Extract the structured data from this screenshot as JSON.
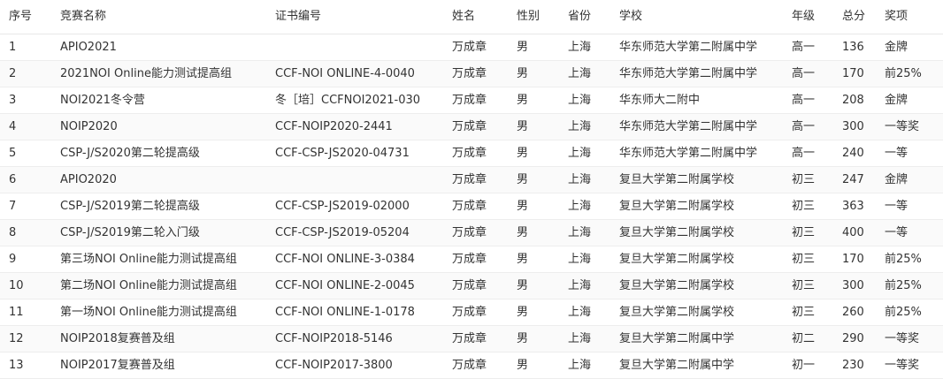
{
  "headers": [
    "序号",
    "竞赛名称",
    "证书编号",
    "姓名",
    "性别",
    "省份",
    "学校",
    "年级",
    "总分",
    "奖项"
  ],
  "rows": [
    {
      "idx": "1",
      "contest": "APIO2021",
      "cert": "",
      "name": "万成章",
      "gender": "男",
      "province": "上海",
      "school": "华东师范大学第二附属中学",
      "grade": "高一",
      "score": "136",
      "award": "金牌"
    },
    {
      "idx": "2",
      "contest": "2021NOI Online能力测试提高组",
      "cert": "CCF-NOI ONLINE-4-0040",
      "name": "万成章",
      "gender": "男",
      "province": "上海",
      "school": "华东师范大学第二附属中学",
      "grade": "高一",
      "score": "170",
      "award": "前25%"
    },
    {
      "idx": "3",
      "contest": "NOI2021冬令营",
      "cert": "冬［培］CCFNOI2021-030",
      "name": "万成章",
      "gender": "男",
      "province": "上海",
      "school": "华东师大二附中",
      "grade": "高一",
      "score": "208",
      "award": "金牌"
    },
    {
      "idx": "4",
      "contest": "NOIP2020",
      "cert": "CCF-NOIP2020-2441",
      "name": "万成章",
      "gender": "男",
      "province": "上海",
      "school": "华东师范大学第二附属中学",
      "grade": "高一",
      "score": "300",
      "award": "一等奖"
    },
    {
      "idx": "5",
      "contest": "CSP-J/S2020第二轮提高级",
      "cert": "CCF-CSP-JS2020-04731",
      "name": "万成章",
      "gender": "男",
      "province": "上海",
      "school": "华东师范大学第二附属中学",
      "grade": "高一",
      "score": "240",
      "award": "一等"
    },
    {
      "idx": "6",
      "contest": "APIO2020",
      "cert": "",
      "name": "万成章",
      "gender": "男",
      "province": "上海",
      "school": "复旦大学第二附属学校",
      "grade": "初三",
      "score": "247",
      "award": "金牌"
    },
    {
      "idx": "7",
      "contest": "CSP-J/S2019第二轮提高级",
      "cert": "CCF-CSP-JS2019-02000",
      "name": "万成章",
      "gender": "男",
      "province": "上海",
      "school": "复旦大学第二附属学校",
      "grade": "初三",
      "score": "363",
      "award": "一等"
    },
    {
      "idx": "8",
      "contest": "CSP-J/S2019第二轮入门级",
      "cert": "CCF-CSP-JS2019-05204",
      "name": "万成章",
      "gender": "男",
      "province": "上海",
      "school": "复旦大学第二附属学校",
      "grade": "初三",
      "score": "400",
      "award": "一等"
    },
    {
      "idx": "9",
      "contest": "第三场NOI Online能力测试提高组",
      "cert": "CCF-NOI ONLINE-3-0384",
      "name": "万成章",
      "gender": "男",
      "province": "上海",
      "school": "复旦大学第二附属学校",
      "grade": "初三",
      "score": "170",
      "award": "前25%"
    },
    {
      "idx": "10",
      "contest": "第二场NOI Online能力测试提高组",
      "cert": "CCF-NOI ONLINE-2-0045",
      "name": "万成章",
      "gender": "男",
      "province": "上海",
      "school": "复旦大学第二附属学校",
      "grade": "初三",
      "score": "300",
      "award": "前25%"
    },
    {
      "idx": "11",
      "contest": "第一场NOI Online能力测试提高组",
      "cert": "CCF-NOI ONLINE-1-0178",
      "name": "万成章",
      "gender": "男",
      "province": "上海",
      "school": "复旦大学第二附属学校",
      "grade": "初三",
      "score": "260",
      "award": "前25%"
    },
    {
      "idx": "12",
      "contest": "NOIP2018复赛普及组",
      "cert": "CCF-NOIP2018-5146",
      "name": "万成章",
      "gender": "男",
      "province": "上海",
      "school": "复旦大学第二附属中学",
      "grade": "初二",
      "score": "290",
      "award": "一等奖"
    },
    {
      "idx": "13",
      "contest": "NOIP2017复赛普及组",
      "cert": "CCF-NOIP2017-3800",
      "name": "万成章",
      "gender": "男",
      "province": "上海",
      "school": "复旦大学第二附属中学",
      "grade": "初一",
      "score": "230",
      "award": "一等奖"
    }
  ],
  "colors": {
    "header_border": "#e8e8e8",
    "row_alt": "#fafafa",
    "row_border": "#ededed",
    "text": "#333333"
  }
}
